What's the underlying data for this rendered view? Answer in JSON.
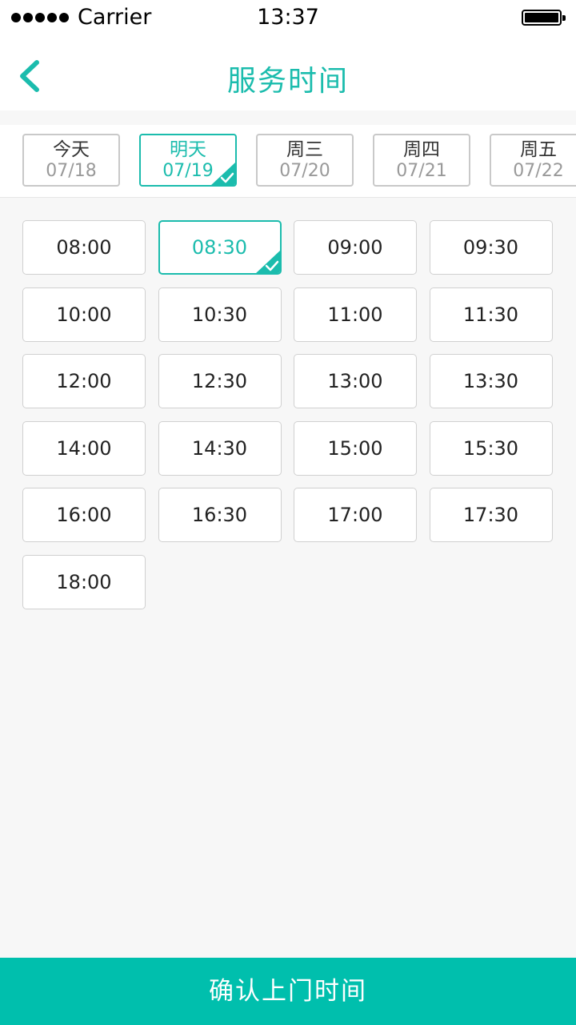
{
  "status_bar": {
    "carrier": "Carrier",
    "time": "13:37",
    "battery_level": 1.0
  },
  "nav": {
    "title": "服务时间",
    "back_icon": "chevron-left-icon"
  },
  "dates": [
    {
      "day": "今天",
      "date": "07/18",
      "selected": false
    },
    {
      "day": "明天",
      "date": "07/19",
      "selected": true
    },
    {
      "day": "周三",
      "date": "07/20",
      "selected": false
    },
    {
      "day": "周四",
      "date": "07/21",
      "selected": false
    },
    {
      "day": "周五",
      "date": "07/22",
      "selected": false
    }
  ],
  "time_slots": [
    {
      "time": "08:00",
      "selected": false
    },
    {
      "time": "08:30",
      "selected": true
    },
    {
      "time": "09:00",
      "selected": false
    },
    {
      "time": "09:30",
      "selected": false
    },
    {
      "time": "10:00",
      "selected": false
    },
    {
      "time": "10:30",
      "selected": false
    },
    {
      "time": "11:00",
      "selected": false
    },
    {
      "time": "11:30",
      "selected": false
    },
    {
      "time": "12:00",
      "selected": false
    },
    {
      "time": "12:30",
      "selected": false
    },
    {
      "time": "13:00",
      "selected": false
    },
    {
      "time": "13:30",
      "selected": false
    },
    {
      "time": "14:00",
      "selected": false
    },
    {
      "time": "14:30",
      "selected": false
    },
    {
      "time": "15:00",
      "selected": false
    },
    {
      "time": "15:30",
      "selected": false
    },
    {
      "time": "16:00",
      "selected": false
    },
    {
      "time": "16:30",
      "selected": false
    },
    {
      "time": "17:00",
      "selected": false
    },
    {
      "time": "17:30",
      "selected": false
    },
    {
      "time": "18:00",
      "selected": false
    }
  ],
  "confirm_label": "确认上门时间",
  "colors": {
    "accent": "#1bbcad",
    "button": "#00bfad",
    "background": "#f7f7f7",
    "border": "#d0d0d0"
  },
  "icons": {
    "selected_check": "checkmark-corner-icon"
  }
}
